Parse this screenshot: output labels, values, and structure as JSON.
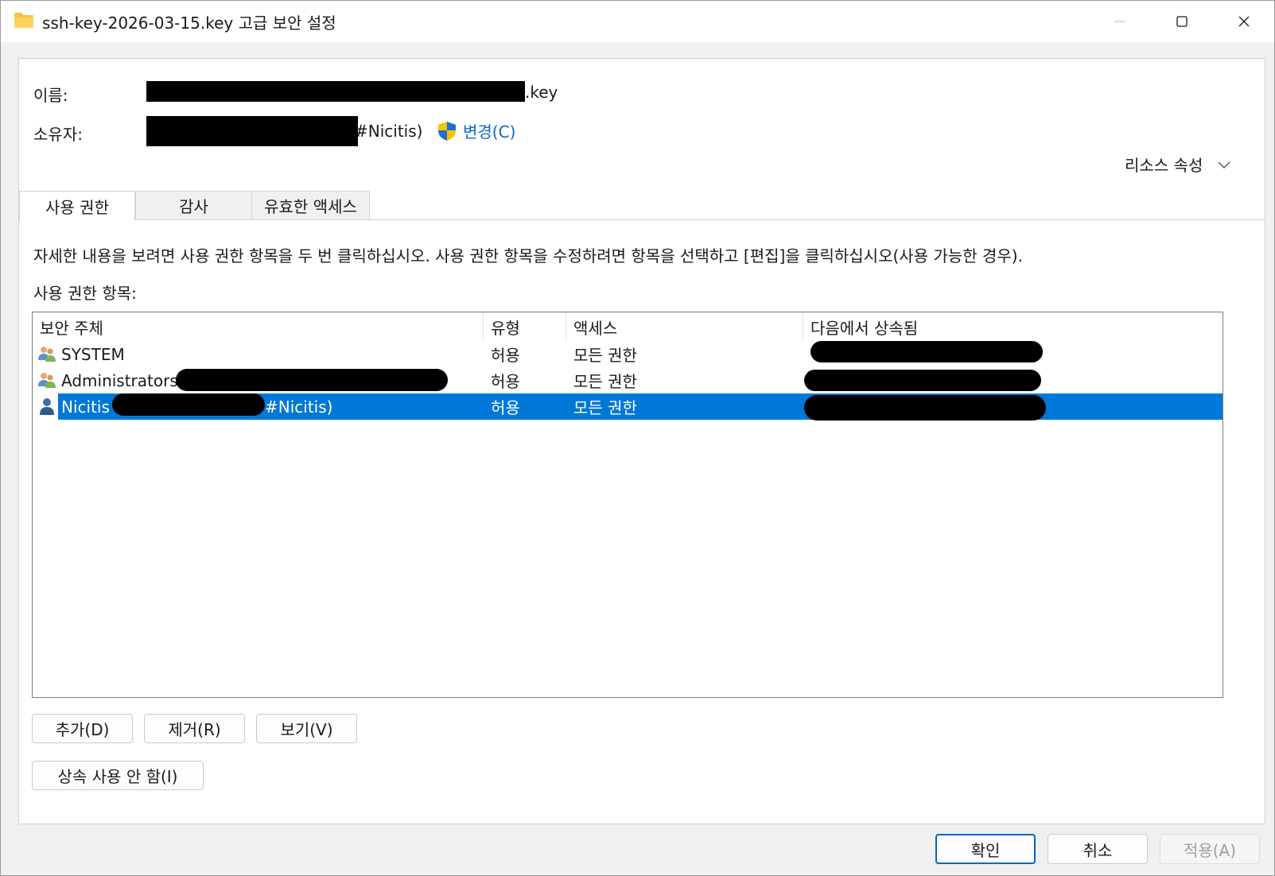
{
  "window": {
    "title": "ssh-key-2026-03-15.key 고급 보안 설정",
    "icons": {
      "folder": "folder-icon",
      "minimize": "minimize-icon",
      "maximize": "maximize-icon",
      "close": "close-icon"
    }
  },
  "header": {
    "name_label": "이름:",
    "name_value_suffix": ".key",
    "owner_label": "소유자:",
    "owner_value_suffix": "#Nicitis)",
    "change_link": "변경(C)",
    "change_icon": "uac-shield-icon",
    "resource_props": "리소스 속성"
  },
  "tabs": [
    {
      "label": "사용 권한",
      "active": true
    },
    {
      "label": "감사",
      "active": false
    },
    {
      "label": "유효한 액세스",
      "active": false
    }
  ],
  "description": "자세한 내용을 보려면 사용 권한 항목을 두 번 클릭하십시오. 사용 권한 항목을 수정하려면 항목을 선택하고 [편집]을 클릭하십시오(사용 가능한 경우).",
  "entries_label": "사용 권한 항목:",
  "list": {
    "columns": [
      "보안 주체",
      "유형",
      "액세스",
      "다음에서 상속됨"
    ],
    "rows": [
      {
        "principal": "SYSTEM",
        "type": "허용",
        "access": "모든 권한",
        "icon": "group-users-icon",
        "selected": false
      },
      {
        "principal": "Administrators",
        "type": "허용",
        "access": "모든 권한",
        "icon": "group-users-icon",
        "selected": false
      },
      {
        "principal": "Nicitis (",
        "principal_suffix": "#Nicitis)",
        "type": "허용",
        "access": "모든 권한",
        "icon": "user-icon",
        "selected": true
      }
    ]
  },
  "buttons": {
    "add": "추가(D)",
    "remove": "제거(R)",
    "view": "보기(V)",
    "disable_inheritance": "상속 사용 안 함(I)",
    "ok": "확인",
    "cancel": "취소",
    "apply": "적용(A)"
  },
  "colors": {
    "selection": "#0078d7",
    "link": "#0a66c7",
    "primary_border": "#0067c0"
  }
}
